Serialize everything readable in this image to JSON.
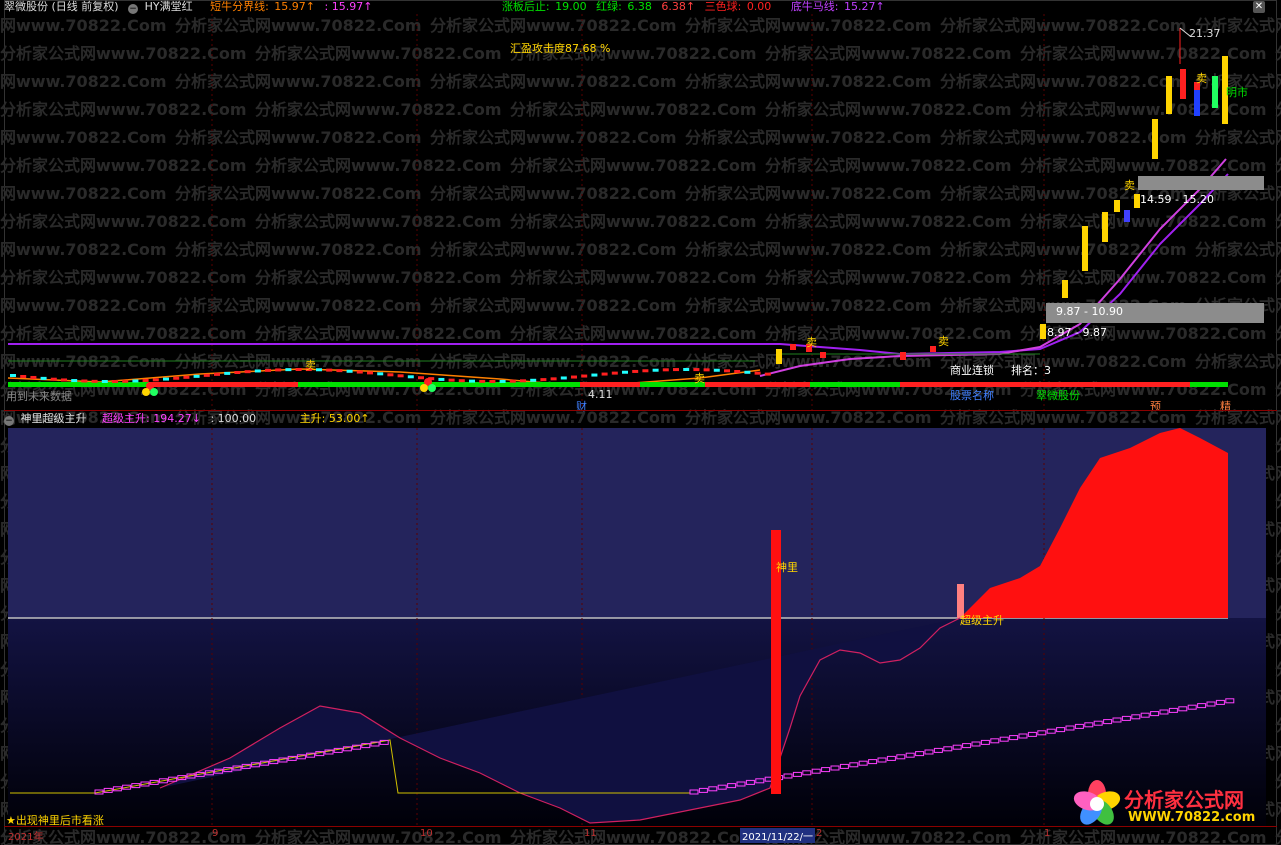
{
  "top_header": {
    "stock": "翠微股份 (日线 前复权)",
    "indicator": "HY满堂红",
    "short_bull_label": "短牛分界线:",
    "short_bull_v1": "15.97↑",
    "short_bull_v2": ": 15.97↑",
    "limit_stop_label": "涨板后止:",
    "limit_stop_val": "19.00",
    "red_green_label": "红绿:",
    "red_green_v1": "6.38",
    "red_green_v2": "6.38↑",
    "three_color_label": "三色球:",
    "three_color_val": "0.00",
    "bottom_bull_label": "底牛马线:",
    "bottom_bull_val": "15.27↑"
  },
  "main_chart": {
    "attack_text": "汇盈攻击度87.68 %",
    "high_price": "21.37",
    "range1": "14.59 - 15.20",
    "range2": "9.87 - 10.90",
    "range3": "8.97 - 9.87",
    "price_label": "4.11",
    "sell_mark": "卖",
    "cai_mark": "财",
    "sector": "商业连锁",
    "rank": "排名：3",
    "stock_name_label": "股票名称",
    "stock_name": "翠微股份",
    "pre_mark": "预",
    "yi_mark": "精",
    "shi_mark": "明市",
    "no_data": "用到未来数据"
  },
  "sub_header": {
    "title": "神里超级主升",
    "super_label": "超级主升:",
    "super_val": "194.27↓",
    "ratio": ": 100.00",
    "main_label": "主升:",
    "main_val": "53.00↑"
  },
  "sub_chart": {
    "shen_label": "神里",
    "super_label": "超级主升",
    "tip": "★出现神里后市看涨"
  },
  "date_axis": [
    "2021年",
    "9",
    "10",
    "11",
    "2021/11/22/一",
    "2",
    "1"
  ],
  "watermark_text": "分析家公式网www.70822.Com",
  "logo": {
    "cn": "分析家公式网",
    "url": "WWW.70822.com"
  },
  "colors": {
    "up": "#ff2020",
    "down": "#20ffff",
    "yellow": "#ffd400",
    "purple": "#a020f0",
    "magenta": "#ff20ff",
    "green": "#00e000",
    "grid": "#8b0000"
  }
}
